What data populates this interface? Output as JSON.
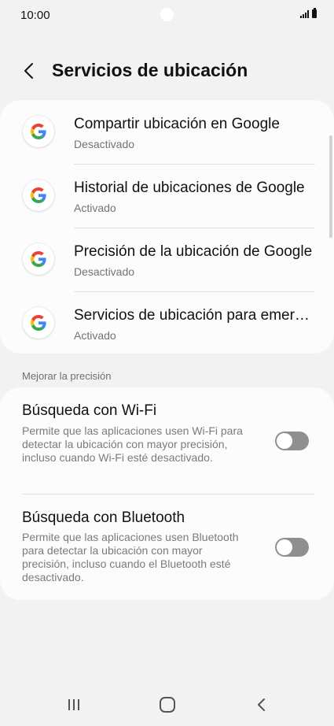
{
  "status_bar": {
    "time": "10:00"
  },
  "header": {
    "title": "Servicios de ubicación"
  },
  "google_items": [
    {
      "title": "Compartir ubicación en Google",
      "status": "Desactivado",
      "icon": "google-icon"
    },
    {
      "title": "Historial de ubicaciones de Google",
      "status": "Activado",
      "icon": "google-icon"
    },
    {
      "title": "Precisión de la ubicación de Google",
      "status": "Desactivado",
      "icon": "google-icon"
    },
    {
      "title": "Servicios de ubicación para emergencias",
      "status": "Activado",
      "icon": "google-icon"
    }
  ],
  "section": {
    "label": "Mejorar la precisión"
  },
  "toggles": [
    {
      "title": "Búsqueda con Wi-Fi",
      "description": "Permite que las aplicaciones usen Wi-Fi para detectar la ubicación con mayor precisión, incluso cuando Wi-Fi esté desactivado.",
      "enabled": false
    },
    {
      "title": "Búsqueda con Bluetooth",
      "description": "Permite que las aplicaciones usen Bluetooth para detectar la ubicación con mayor precisión, incluso cuando el Bluetooth esté desactivado.",
      "enabled": false
    }
  ],
  "colors": {
    "background": "#f2f2f2",
    "card": "#fcfcfc",
    "toggle_off": "#8f8f8f",
    "google_blue": "#4285F4",
    "google_red": "#EA4335",
    "google_yellow": "#FBBC05",
    "google_green": "#34A853"
  },
  "nav_bar": {
    "icons": [
      "recents-icon",
      "home-icon",
      "back-icon"
    ]
  }
}
